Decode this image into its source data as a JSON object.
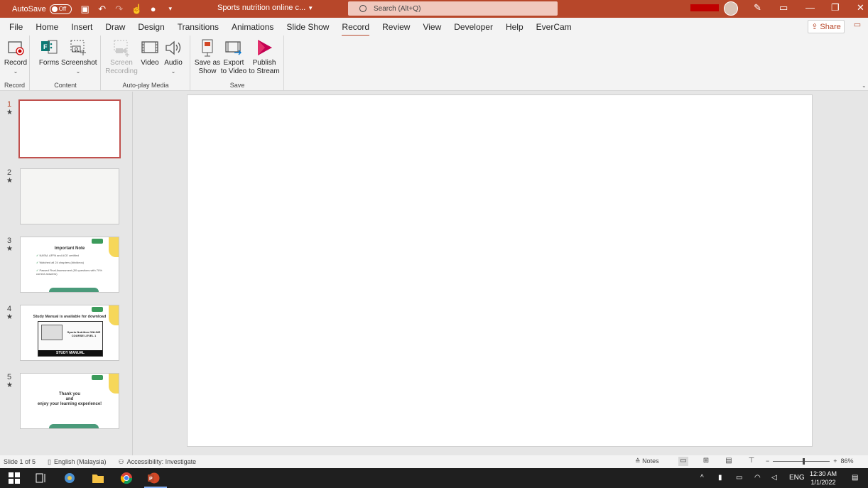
{
  "titlebar": {
    "autosave_label": "AutoSave",
    "autosave_state": "Off",
    "doc_title": "Sports nutrition online c...",
    "search_placeholder": "Search (Alt+Q)",
    "bg_color": "#b7472a"
  },
  "menu": {
    "items": [
      "File",
      "Home",
      "Insert",
      "Draw",
      "Design",
      "Transitions",
      "Animations",
      "Slide Show",
      "Record",
      "Review",
      "View",
      "Developer",
      "Help",
      "EverCam"
    ],
    "active": "Record",
    "share_label": "Share"
  },
  "ribbon": {
    "groups": [
      {
        "label": "Record",
        "buttons": [
          {
            "line1": "Record",
            "line2": "",
            "icon": "record-icon",
            "enabled": true
          }
        ]
      },
      {
        "label": "Content",
        "buttons": [
          {
            "line1": "Forms",
            "line2": "",
            "icon": "forms-icon",
            "enabled": true
          },
          {
            "line1": "Screenshot",
            "line2": "",
            "icon": "screenshot-icon",
            "enabled": true
          }
        ]
      },
      {
        "label": "Auto-play Media",
        "buttons": [
          {
            "line1": "Screen",
            "line2": "Recording",
            "icon": "screen-recording-icon",
            "enabled": false
          },
          {
            "line1": "Video",
            "line2": "",
            "icon": "video-icon",
            "enabled": true
          },
          {
            "line1": "Audio",
            "line2": "",
            "icon": "audio-icon",
            "enabled": true
          }
        ]
      },
      {
        "label": "Save",
        "buttons": [
          {
            "line1": "Save as",
            "line2": "Show",
            "icon": "save-as-show-icon",
            "enabled": true
          },
          {
            "line1": "Export",
            "line2": "to Video",
            "icon": "export-video-icon",
            "enabled": true
          },
          {
            "line1": "Publish",
            "line2": "to Stream",
            "icon": "publish-stream-icon",
            "enabled": true
          }
        ]
      }
    ]
  },
  "slides": [
    {
      "num": "1",
      "star": "★",
      "selected": true
    },
    {
      "num": "2",
      "star": "★"
    },
    {
      "num": "3",
      "star": "★",
      "title": "Important Note",
      "bullets": [
        "NASM, AFPA and ACE certified",
        "Watched all 24 chapters (##videos)",
        "Passed Final Assessment (50 questions with 70% correct answers)"
      ]
    },
    {
      "num": "4",
      "star": "★",
      "title": "Study Manual is available for download",
      "inner_title": "Sports Nutrition ONLINE COURSE LEVEL 1",
      "footer": "STUDY MANUAL"
    },
    {
      "num": "5",
      "star": "★",
      "lines": [
        "Thank you",
        "and",
        "enjoy your learning experience!"
      ]
    }
  ],
  "status": {
    "slide_info": "Slide 1 of 5",
    "language": "English (Malaysia)",
    "accessibility": "Accessibility: Investigate",
    "notes_label": "Notes",
    "zoom": "86%"
  },
  "taskbar": {
    "lang": "ENG",
    "time": "12:30 AM",
    "date": "1/1/2022"
  }
}
